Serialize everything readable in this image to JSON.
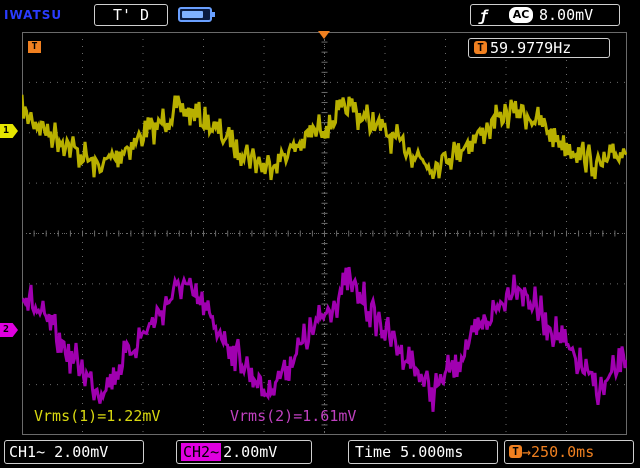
{
  "header": {
    "brand": "IWATSU",
    "trigger_status": "T' D",
    "battery_level": 0.8,
    "trigger_slope_icon": "rising-edge-icon",
    "trigger_coupling": "AC",
    "trigger_level": "8.00mV"
  },
  "screen": {
    "trigger_marker": "T",
    "frequency_label": "T",
    "frequency": "59.9779Hz",
    "ch1_marker": "1",
    "ch2_marker": "2",
    "measurement_ch1": "Vrms(1)=1.22mV",
    "measurement_ch2": "Vrms(2)=1.61mV",
    "colors": {
      "ch1": "#b8b000",
      "ch2": "#a000b0",
      "grid": "#6a6a6a",
      "trigger": "#f08020"
    }
  },
  "footer": {
    "ch1_scale": "CH1~ 2.00mV",
    "ch2_tag": "CH2~",
    "ch2_scale": "2.00mV",
    "timebase": "Time 5.000ms",
    "delay_tag": "T",
    "delay_value": "→250.0ms"
  }
}
